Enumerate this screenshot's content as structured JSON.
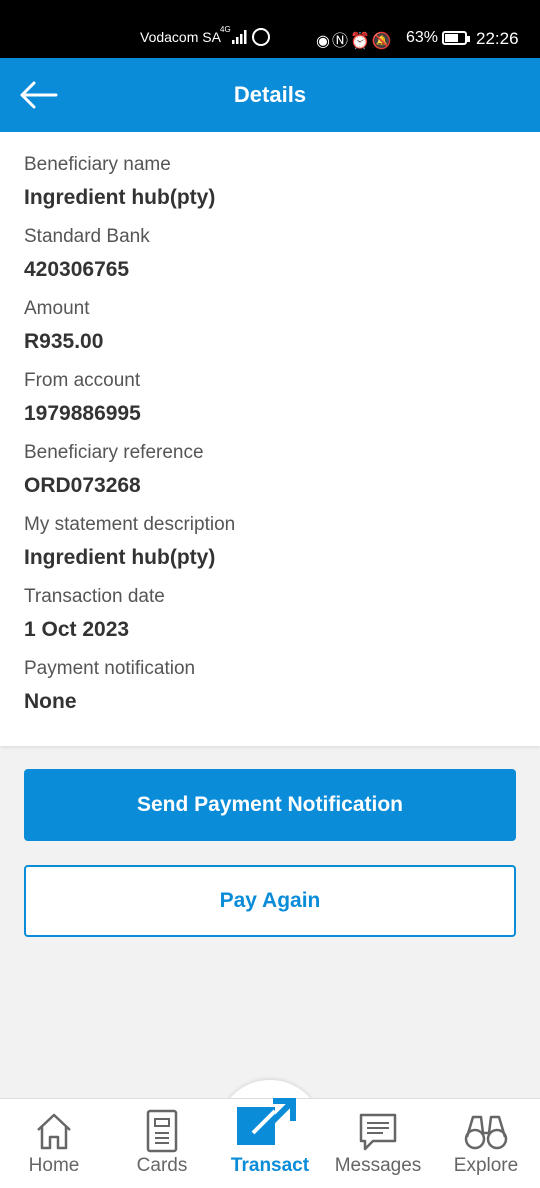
{
  "status_bar": {
    "carrier": "Vodacom SA",
    "network": "4G",
    "battery": "63%",
    "time": "22:26"
  },
  "header": {
    "title": "Details",
    "back_icon": "arrow-left-icon"
  },
  "details": {
    "beneficiary_name_label": "Beneficiary name",
    "beneficiary_name_value": "Ingredient hub(pty)",
    "bank_label": "Standard Bank",
    "bank_value": "420306765",
    "amount_label": "Amount",
    "amount_value": "R935.00",
    "from_account_label": "From account",
    "from_account_value": "1979886995",
    "beneficiary_reference_label": "Beneficiary reference",
    "beneficiary_reference_value": "ORD073268",
    "statement_description_label": "My statement description",
    "statement_description_value": "Ingredient hub(pty)",
    "transaction_date_label": "Transaction date",
    "transaction_date_value": "1 Oct 2023",
    "payment_notification_label": "Payment notification",
    "payment_notification_value": "None"
  },
  "actions": {
    "send_notification_label": "Send Payment Notification",
    "pay_again_label": "Pay Again"
  },
  "bottom_nav": {
    "home": "Home",
    "cards": "Cards",
    "transact": "Transact",
    "messages": "Messages",
    "explore": "Explore",
    "active": "Transact"
  },
  "colors": {
    "brand_blue": "#0a8cd9",
    "background": "#f2f2f2"
  }
}
